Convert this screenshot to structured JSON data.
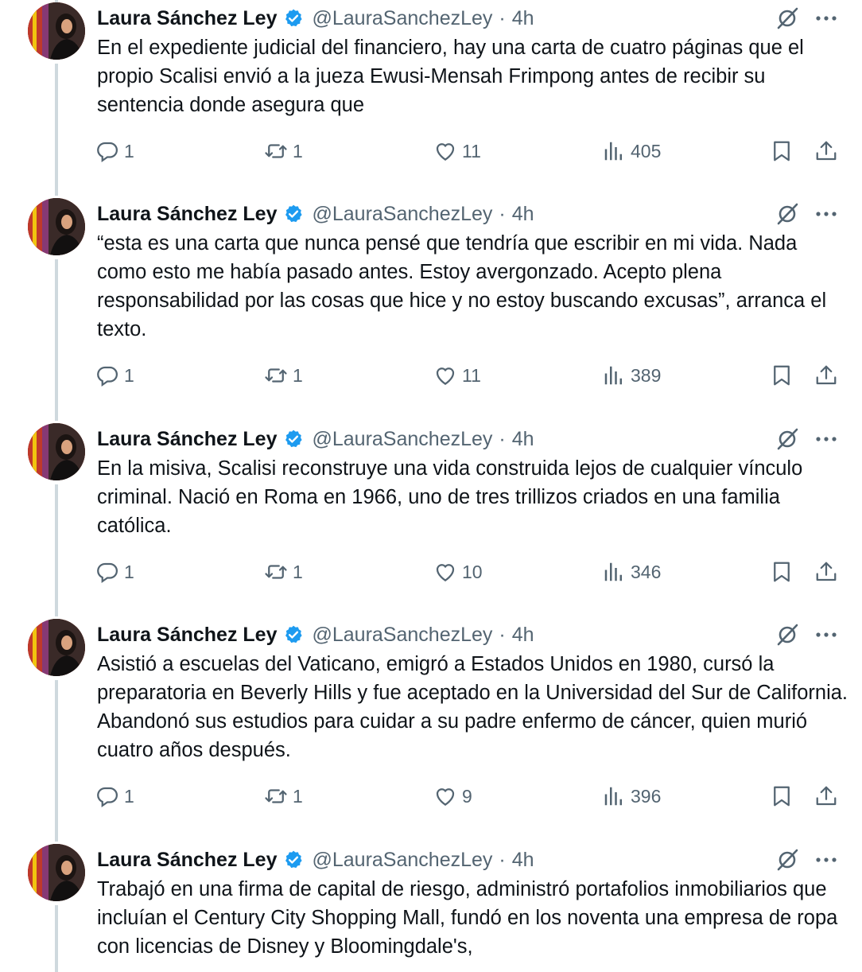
{
  "author": {
    "name": "Laura Sánchez Ley",
    "handle": "@LauraSanchezLey",
    "separator": "·",
    "time": "4h"
  },
  "icons": {
    "verified": "verified-badge-icon",
    "grok": "grok-icon",
    "more": "more-icon",
    "reply": "reply-icon",
    "retweet": "retweet-icon",
    "like": "like-icon",
    "views": "views-icon",
    "bookmark": "bookmark-icon",
    "share": "share-icon"
  },
  "colors": {
    "verified": "#1d9bf0",
    "muted": "#536471",
    "thread_line": "#cfd9de"
  },
  "tweets": [
    {
      "text": "En el expediente judicial del financiero, hay una carta de cuatro páginas que el propio Scalisi envió a la jueza Ewusi-Mensah Frimpong antes de recibir su sentencia donde asegura que",
      "replies": "1",
      "retweets": "1",
      "likes": "11",
      "views": "405"
    },
    {
      "text": "“esta es una carta que nunca pensé que tendría que escribir en mi vida. Nada como esto me había pasado antes. Estoy avergonzado. Acepto plena responsabilidad por las cosas que hice y no estoy buscando excusas”, arranca el texto.",
      "replies": "1",
      "retweets": "1",
      "likes": "11",
      "views": "389"
    },
    {
      "text": "En la misiva, Scalisi reconstruye una vida construida lejos de cualquier vínculo criminal. Nació en Roma en 1966, uno de tres trillizos criados en una familia católica.",
      "replies": "1",
      "retweets": "1",
      "likes": "10",
      "views": "346"
    },
    {
      "text": "Asistió a escuelas del Vaticano, emigró a Estados Unidos en 1980, cursó la preparatoria en Beverly Hills y fue aceptado en la Universidad del Sur de California. Abandonó sus estudios para cuidar a su padre enfermo de cáncer, quien murió cuatro años después.",
      "replies": "1",
      "retweets": "1",
      "likes": "9",
      "views": "396"
    },
    {
      "text": "Trabajó en una firma de capital de riesgo, administró portafolios inmobiliarios que incluían el Century City Shopping Mall, fundó en los noventa una empresa de ropa con licencias de Disney y Bloomingdale's,"
    }
  ]
}
